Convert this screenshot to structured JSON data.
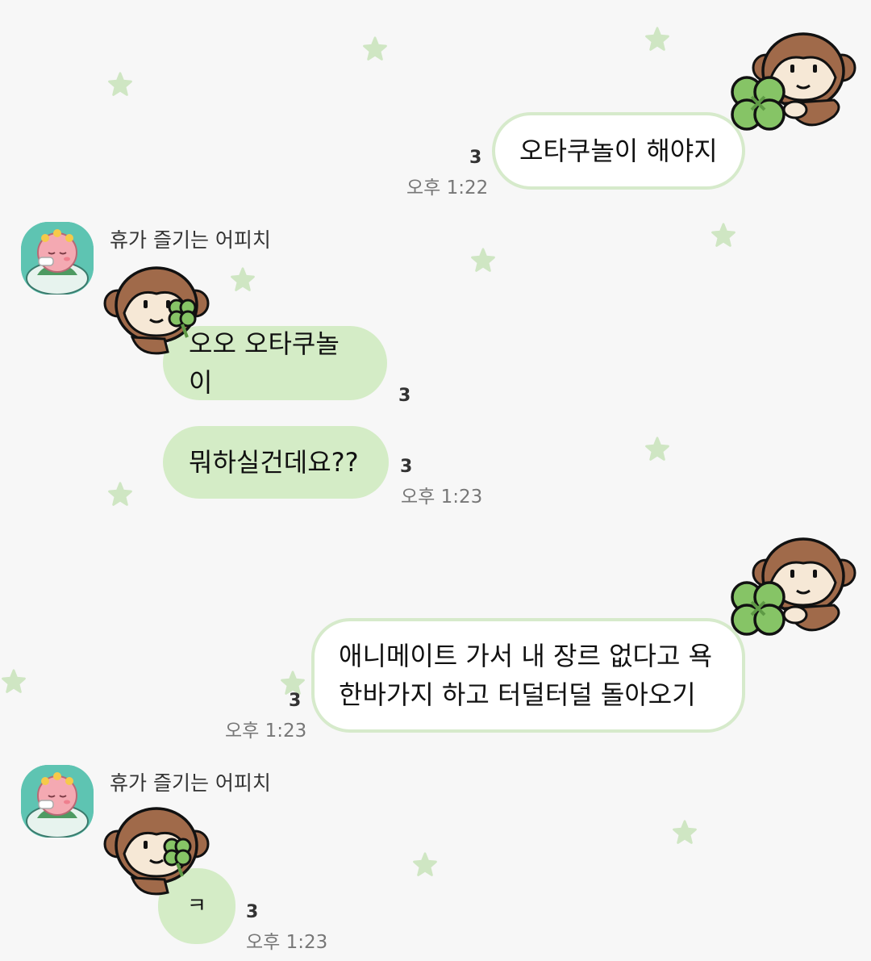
{
  "colors": {
    "background": "#f7f7f7",
    "incoming_bubble": "#d4ecc6",
    "outgoing_border": "#d6eacb",
    "star": "#cfe6c3"
  },
  "messages": {
    "m1": {
      "text": "오타쿠놀이 해야지",
      "unread": "3",
      "time": "오후 1:22"
    },
    "sender_a": "휴가 즐기는 어피치",
    "m2": {
      "text": "오오 오타쿠놀이",
      "unread": "3"
    },
    "m3": {
      "text": "뭐하실건데요??",
      "unread": "3",
      "time": "오후 1:23"
    },
    "m4": {
      "line1": "애니메이트 가서 내 장르 없다고 욕",
      "line2": "한바가지 하고 터덜터덜 돌아오기",
      "unread": "3",
      "time": "오후 1:23"
    },
    "sender_b": "휴가 즐기는 어피치",
    "m5": {
      "text": "ㅋ",
      "unread": "3",
      "time": "오후 1:23"
    }
  },
  "icons": {
    "avatar": "apeach-avatar",
    "sticker": "monkey-clover-sticker",
    "pattern": "star-icon"
  }
}
